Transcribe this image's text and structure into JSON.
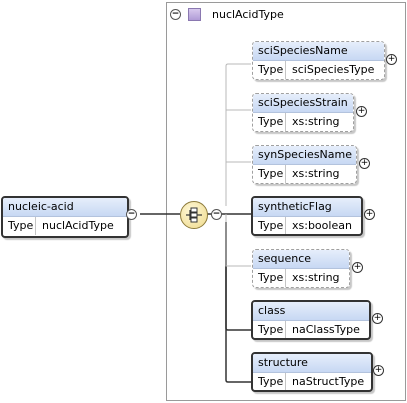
{
  "root": {
    "name": "nucleic-acid",
    "type_label": "Type",
    "type_value": "nuclAcidType"
  },
  "complex_type": {
    "collapse_symbol": "⊖",
    "name": "nuclAcidType"
  },
  "compositor": {
    "kind": "sequence",
    "collapse_symbol": "⊖"
  },
  "children": [
    {
      "name": "sciSpeciesName",
      "type_label": "Type",
      "type_value": "sciSpeciesType",
      "optional": true,
      "expand": "⊕"
    },
    {
      "name": "sciSpeciesStrain",
      "type_label": "Type",
      "type_value": "xs:string",
      "optional": true,
      "expand": "⊕"
    },
    {
      "name": "synSpeciesName",
      "type_label": "Type",
      "type_value": "xs:string",
      "optional": true,
      "expand": "⊕"
    },
    {
      "name": "syntheticFlag",
      "type_label": "Type",
      "type_value": "xs:boolean",
      "optional": false,
      "expand": "⊕"
    },
    {
      "name": "sequence",
      "type_label": "Type",
      "type_value": "xs:string",
      "optional": true,
      "expand": "⊕"
    },
    {
      "name": "class",
      "type_label": "Type",
      "type_value": "naClassType",
      "optional": false,
      "expand": "⊕"
    },
    {
      "name": "structure",
      "type_label": "Type",
      "type_value": "naStructType",
      "optional": false,
      "expand": "⊕"
    }
  ]
}
